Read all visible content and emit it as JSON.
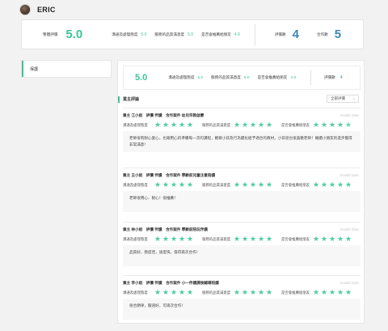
{
  "user": {
    "name": "ERIC"
  },
  "summary": {
    "overall_label": "整體評價",
    "overall_value": "5.0",
    "metrics": [
      {
        "label": "溝通及處理態度",
        "value": "5.0"
      },
      {
        "label": "服務的品質滿意度",
        "value": "5.0"
      },
      {
        "label": "是否會推薦給朋友",
        "value": "4.9"
      }
    ],
    "reviews_label": "評價數",
    "reviews_count": "4",
    "cooperation_label": "合作數",
    "cooperation_count": "5"
  },
  "sidebar": {
    "items": [
      {
        "label": "保護"
      }
    ]
  },
  "sub_summary": {
    "overall_value": "5.0",
    "metrics": [
      {
        "label": "溝通及處理態度",
        "value": "5.0"
      },
      {
        "label": "服務的品質滿意度",
        "value": "5.0"
      },
      {
        "label": "是否會推薦給朋友",
        "value": "4.9"
      }
    ],
    "reviews_label": "評價數",
    "reviews_count": "4"
  },
  "reviews_section": {
    "title": "業主評論",
    "filter_value": "全部評價"
  },
  "rating_labels": [
    "溝通及處理態度",
    "服務的品質滿意度",
    "是否會推薦給朋友"
  ],
  "reviews": [
    {
      "title": "業主 江小姐　評價 伴讀　合作案件 幼兒早教啟蒙",
      "status": "Invalid Date",
      "stars": [
        5,
        5,
        5
      ],
      "stars_fraction": [
        1,
        1,
        0.9
      ],
      "comment": "老師很有耐心愛心，也跟用心的準備每一次的課程，觀察小孩及行為變化給予適合的教材，小孩從也很喜歡老師！繼續小朋友的進步獲得非常滿意！"
    },
    {
      "title": "業主 王小姐　評價 伴讀　合作案件 學齡前兒童注意陪讀",
      "status": "Invalid Date",
      "stars": [
        5,
        5,
        5
      ],
      "stars_fraction": [
        1,
        1,
        1
      ],
      "comment": "老師很用心、耐心！很推薦！"
    },
    {
      "title": "業主 林小姐　評價 伴讀　合作案件 學齡前陪玩伴讀",
      "status": "Invalid Date",
      "stars": [
        5,
        5,
        5
      ],
      "stars_fraction": [
        1,
        1,
        1
      ],
      "comment": "品質好，態度佳，速度快，值得再次合作！"
    },
    {
      "title": "業主 李小姐　評價 伴讀　合作案件 小一伴讀課後輔導陪讀",
      "status": "Invalid Date",
      "stars": [
        5,
        5,
        5
      ],
      "stars_fraction": [
        1,
        1,
        1
      ],
      "comment": "很合節律，服道好，可再次合作！"
    }
  ],
  "colors": {
    "accent_green": "#3cc49a",
    "accent_blue": "#3b86b3",
    "star_green": "#4ecba3"
  }
}
